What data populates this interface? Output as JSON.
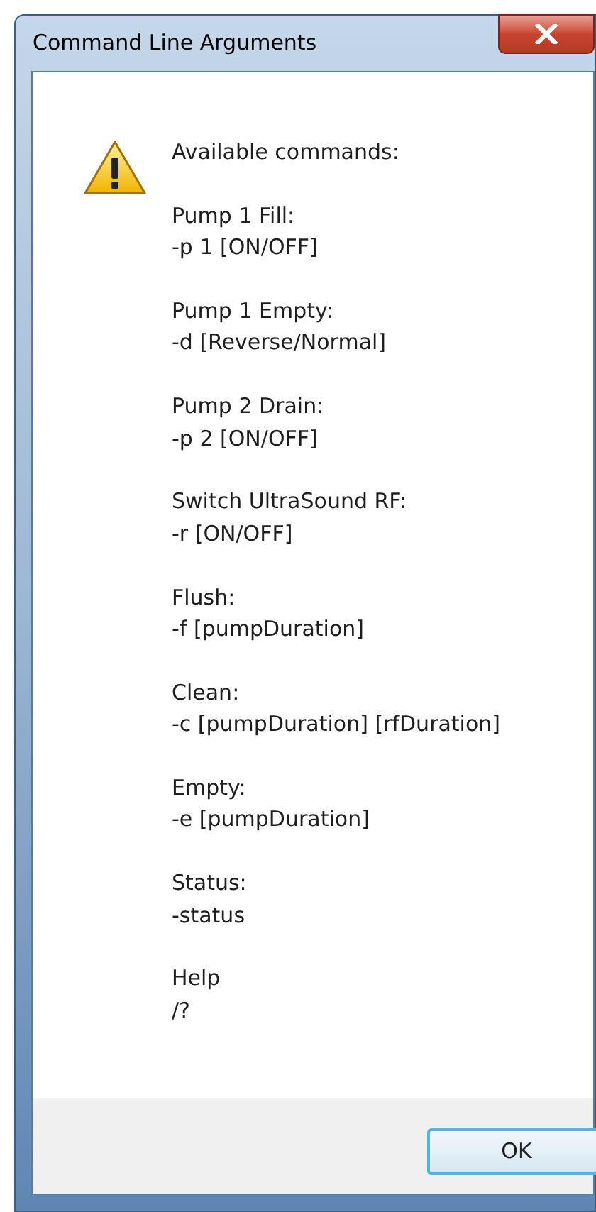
{
  "window": {
    "title": "Command Line Arguments"
  },
  "message": {
    "heading": "Available commands:",
    "commands": [
      {
        "name": "Pump 1 Fill:",
        "syntax": "-p 1 [ON/OFF]"
      },
      {
        "name": "Pump 1 Empty:",
        "syntax": "-d [Reverse/Normal]"
      },
      {
        "name": "Pump 2 Drain:",
        "syntax": "-p 2 [ON/OFF]"
      },
      {
        "name": "Switch UltraSound RF:",
        "syntax": "-r [ON/OFF]"
      },
      {
        "name": "Flush:",
        "syntax": "-f [pumpDuration]"
      },
      {
        "name": "Clean:",
        "syntax": "-c [pumpDuration] [rfDuration]"
      },
      {
        "name": "Empty:",
        "syntax": "-e [pumpDuration]"
      },
      {
        "name": "Status:",
        "syntax": "-status"
      },
      {
        "name": "Help",
        "syntax": "/?"
      }
    ]
  },
  "buttons": [
    "OK"
  ]
}
